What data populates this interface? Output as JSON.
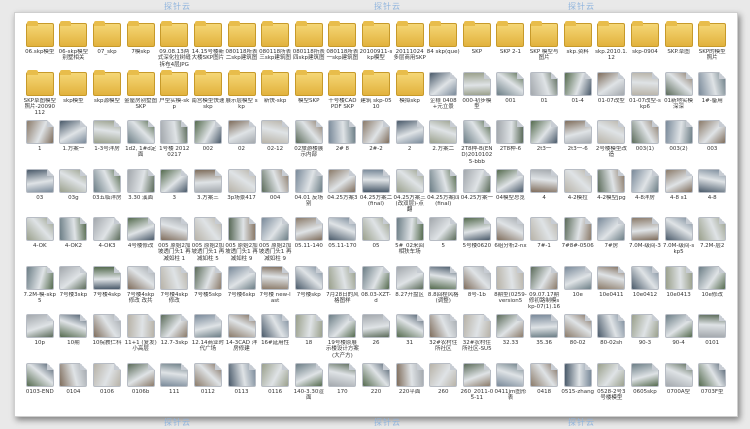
{
  "watermark": "探针云",
  "files": [
    {
      "label": "06.skp模型",
      "type": "folder"
    },
    {
      "label": "06-skp模型别墅相关",
      "type": "folder"
    },
    {
      "label": "07_skp",
      "type": "folder"
    },
    {
      "label": "7模skp",
      "type": "folder"
    },
    {
      "label": "09.08.13两式深化拉树缝拆布4层JPG和SKP",
      "type": "folder"
    },
    {
      "label": "14.15号楼新大楼SKP图片",
      "type": "folder"
    },
    {
      "label": "080118所表二skp建筑图",
      "type": "folder"
    },
    {
      "label": "080118所表三skp建筑图",
      "type": "folder"
    },
    {
      "label": "080118所表四skp建筑图",
      "type": "folder"
    },
    {
      "label": "080118所表一skp建筑图",
      "type": "folder"
    },
    {
      "label": "20100911-skp模型",
      "type": "folder"
    },
    {
      "label": "20111024多层商用SKP",
      "type": "folder"
    },
    {
      "label": "84 skp(que)",
      "type": "folder"
    },
    {
      "label": "SKP",
      "type": "folder"
    },
    {
      "label": "SKP 2-1",
      "type": "folder"
    },
    {
      "label": "SKP 模型与图片",
      "type": "folder"
    },
    {
      "label": "skp.资料",
      "type": "folder"
    },
    {
      "label": "skp.2010.1.12",
      "type": "folder"
    },
    {
      "label": "skp-0904",
      "type": "folder"
    },
    {
      "label": "SKP.草图",
      "type": "folder"
    },
    {
      "label": "SKP的模型 照片",
      "type": "folder"
    },
    {
      "label": "SKP草图模型 照片-20090112",
      "type": "folder"
    },
    {
      "label": "skp模型",
      "type": "folder"
    },
    {
      "label": "skp源模型",
      "type": "folder"
    },
    {
      "label": "金屋房别墅图SKP",
      "type": "folder"
    },
    {
      "label": "户型实模-skp",
      "type": "folder"
    },
    {
      "label": "南宫模型快速 skp",
      "type": "folder"
    },
    {
      "label": "展示层模型 skp",
      "type": "folder"
    },
    {
      "label": "新快-skp",
      "type": "folder"
    },
    {
      "label": "模型SKP",
      "type": "folder"
    },
    {
      "label": "十号楼CAD PDF SKP",
      "type": "folder"
    },
    {
      "label": "建筑 skp-0510",
      "type": "folder"
    },
    {
      "label": "模拟skp",
      "type": "folder"
    },
    {
      "label": "企様 0408+元立景",
      "type": "file"
    },
    {
      "label": "000-初步模型",
      "type": "file"
    },
    {
      "label": "001",
      "type": "file"
    },
    {
      "label": "01",
      "type": "file"
    },
    {
      "label": "01-4",
      "type": "file"
    },
    {
      "label": "01-07改型",
      "type": "file"
    },
    {
      "label": "01-07改型-skp6",
      "type": "file"
    },
    {
      "label": "01新地实模 深深",
      "type": "file"
    },
    {
      "label": "1#-备用",
      "type": "file"
    },
    {
      "label": "1",
      "type": "file"
    },
    {
      "label": "1.方案一",
      "type": "file"
    },
    {
      "label": "1-3号洋房",
      "type": "file"
    },
    {
      "label": "1d2, 1#d定面",
      "type": "file"
    },
    {
      "label": "1号楼 20120217",
      "type": "file"
    },
    {
      "label": "002",
      "type": "file"
    },
    {
      "label": "02",
      "type": "file"
    },
    {
      "label": "02-12",
      "type": "file"
    },
    {
      "label": "02旅游楼展示内部",
      "type": "file"
    },
    {
      "label": "2# 8",
      "type": "file"
    },
    {
      "label": "2#-2",
      "type": "file"
    },
    {
      "label": "2",
      "type": "file"
    },
    {
      "label": "2.方案二",
      "type": "file"
    },
    {
      "label": "2T8种-B(END)20101025-bbb",
      "type": "file"
    },
    {
      "label": "2T8种-6",
      "type": "file"
    },
    {
      "label": "2t3一",
      "type": "file"
    },
    {
      "label": "2t3一-6",
      "type": "file"
    },
    {
      "label": "2号楼模型改造",
      "type": "file"
    },
    {
      "label": "003(1)",
      "type": "file"
    },
    {
      "label": "003(2)",
      "type": "file"
    },
    {
      "label": "003",
      "type": "file"
    },
    {
      "label": "03",
      "type": "file"
    },
    {
      "label": "03g",
      "type": "file"
    },
    {
      "label": "03五临洋房",
      "type": "file"
    },
    {
      "label": "3.30 溪面",
      "type": "file"
    },
    {
      "label": "3",
      "type": "file"
    },
    {
      "label": "3.方案三",
      "type": "file"
    },
    {
      "label": "3p场景417",
      "type": "file"
    },
    {
      "label": "004",
      "type": "file"
    },
    {
      "label": "04.01 反场别",
      "type": "file"
    },
    {
      "label": "04.25方案3",
      "type": "file"
    },
    {
      "label": "04.25方案二(final)",
      "type": "file"
    },
    {
      "label": "04.25方案三(改双层)-点翻",
      "type": "file"
    },
    {
      "label": "04.25方案四(final)",
      "type": "file"
    },
    {
      "label": "04.25方案一",
      "type": "file"
    },
    {
      "label": "04模型总览",
      "type": "file"
    },
    {
      "label": "4",
      "type": "file"
    },
    {
      "label": "4-2模拉",
      "type": "file"
    },
    {
      "label": "4-2模型jpg",
      "type": "file"
    },
    {
      "label": "4-8洋房",
      "type": "file"
    },
    {
      "label": "4-8 s1",
      "type": "file"
    },
    {
      "label": "4-8",
      "type": "file"
    },
    {
      "label": "4-OK",
      "type": "file"
    },
    {
      "label": "4-OK2",
      "type": "file"
    },
    {
      "label": "4-OK3",
      "type": "file"
    },
    {
      "label": "4号楼修改",
      "type": "file"
    },
    {
      "label": "005 原始2加坡透门头1 再减如柱 1",
      "type": "file"
    },
    {
      "label": "005 原始2加坡透门头1 再减如柱 5",
      "type": "file"
    },
    {
      "label": "005 原始2加坡透门头1 再减如柱 9",
      "type": "file"
    },
    {
      "label": "005 原始2加坡透门头1 再减如柱 9",
      "type": "file"
    },
    {
      "label": "05.11-140",
      "type": "file"
    },
    {
      "label": "05.11-170",
      "type": "file"
    },
    {
      "label": "05",
      "type": "file"
    },
    {
      "label": "5#_02来回相扶车场",
      "type": "file"
    },
    {
      "label": "5",
      "type": "file"
    },
    {
      "label": "5号楼0620",
      "type": "file"
    },
    {
      "label": "6组分析2-nx",
      "type": "file"
    },
    {
      "label": "7#-1",
      "type": "file"
    },
    {
      "label": "7#8#-0506",
      "type": "file"
    },
    {
      "label": "7#房",
      "type": "file"
    },
    {
      "label": "7.0M-级间-3",
      "type": "file"
    },
    {
      "label": "7.0M-级间-skp5",
      "type": "file"
    },
    {
      "label": "7.2M-层2",
      "type": "file"
    },
    {
      "label": "7.2M-模-skp5",
      "type": "file"
    },
    {
      "label": "7号楼3skp",
      "type": "file"
    },
    {
      "label": "7号楼4skp",
      "type": "file"
    },
    {
      "label": "7号楼4skp修改 改共",
      "type": "file"
    },
    {
      "label": "7号楼4skp修改",
      "type": "file"
    },
    {
      "label": "7号楼5skp",
      "type": "file"
    },
    {
      "label": "7号楼6skp",
      "type": "file"
    },
    {
      "label": "7号楼 new-last",
      "type": "file"
    },
    {
      "label": "7号楼skp",
      "type": "file"
    },
    {
      "label": "7月28日的风格图样",
      "type": "file"
    },
    {
      "label": "08.03-XZT-d",
      "type": "file"
    },
    {
      "label": "8.27开盘区",
      "type": "file"
    },
    {
      "label": "8.8回程风格(调整)",
      "type": "file"
    },
    {
      "label": "8号-1b",
      "type": "file"
    },
    {
      "label": "8期型(0259-version5",
      "type": "file"
    },
    {
      "label": "09.07.17期修初路制模skp-07(1).16",
      "type": "file"
    },
    {
      "label": "10e",
      "type": "file"
    },
    {
      "label": "10e0411",
      "type": "file"
    },
    {
      "label": "10e0412",
      "type": "file"
    },
    {
      "label": "10e0413",
      "type": "file"
    },
    {
      "label": "10e修改",
      "type": "file"
    },
    {
      "label": "10p",
      "type": "file"
    },
    {
      "label": "10期",
      "type": "file"
    },
    {
      "label": "10院教仁科",
      "type": "file"
    },
    {
      "label": "11+1 (复发) 小高层",
      "type": "file"
    },
    {
      "label": "12.7-3skp",
      "type": "file"
    },
    {
      "label": "12.14商业时代广场",
      "type": "file"
    },
    {
      "label": "14-3CAD 洋房修建",
      "type": "file"
    },
    {
      "label": "16#延用性",
      "type": "file"
    },
    {
      "label": "18",
      "type": "file"
    },
    {
      "label": "19号楼原展示楼设计方案(大产方)",
      "type": "file"
    },
    {
      "label": "26",
      "type": "file"
    },
    {
      "label": "31",
      "type": "file"
    },
    {
      "label": "32#农村住所社区",
      "type": "file"
    },
    {
      "label": "32#农村住所社区-SU5",
      "type": "file"
    },
    {
      "label": "32.33",
      "type": "file"
    },
    {
      "label": "35.36",
      "type": "file"
    },
    {
      "label": "80-02",
      "type": "file"
    },
    {
      "label": "80-02sh",
      "type": "file"
    },
    {
      "label": "90-3",
      "type": "file"
    },
    {
      "label": "90-4",
      "type": "file"
    },
    {
      "label": "0101",
      "type": "file"
    },
    {
      "label": "0103-END",
      "type": "file"
    },
    {
      "label": "0104",
      "type": "file"
    },
    {
      "label": "0106",
      "type": "file"
    },
    {
      "label": "0106b",
      "type": "file"
    },
    {
      "label": "111",
      "type": "file"
    },
    {
      "label": "0112",
      "type": "file"
    },
    {
      "label": "0113",
      "type": "file"
    },
    {
      "label": "0116",
      "type": "file"
    },
    {
      "label": "140-3.30渲面",
      "type": "file"
    },
    {
      "label": "170",
      "type": "file"
    },
    {
      "label": "220",
      "type": "file"
    },
    {
      "label": "220平面",
      "type": "file"
    },
    {
      "label": "260",
      "type": "file"
    },
    {
      "label": "260_2011-05-11",
      "type": "file"
    },
    {
      "label": "0411jm图形表",
      "type": "file"
    },
    {
      "label": "0418",
      "type": "file"
    },
    {
      "label": "0515-zhang",
      "type": "file"
    },
    {
      "label": "0528-2号3号楼模型",
      "type": "file"
    },
    {
      "label": "0605skp",
      "type": "file"
    },
    {
      "label": "0700A型",
      "type": "file"
    },
    {
      "label": "0703F型",
      "type": "file"
    }
  ]
}
